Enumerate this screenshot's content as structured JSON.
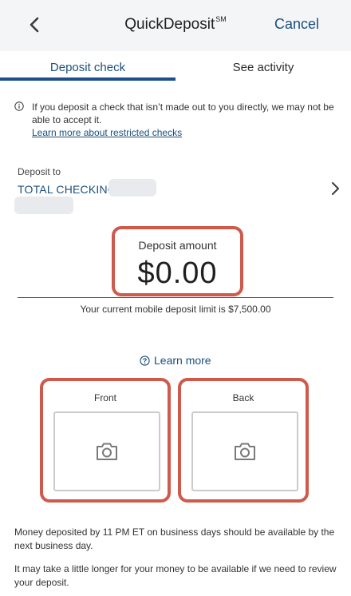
{
  "header": {
    "title": "QuickDeposit",
    "title_mark": "SM",
    "cancel_label": "Cancel",
    "back_icon": "chevron-left-icon"
  },
  "tabs": [
    {
      "label": "Deposit check",
      "active": true
    },
    {
      "label": "See activity",
      "active": false
    }
  ],
  "notice": {
    "text": "If you deposit a check that isn’t made out to you directly, we may not be able to accept it.",
    "link": "Learn more about restricted checks",
    "icon": "info-icon"
  },
  "deposit_to": {
    "label": "Deposit to",
    "account_name": "TOTAL CHECKING"
  },
  "amount": {
    "label": "Deposit amount",
    "value": "$0.00",
    "limit_text": "Your current mobile deposit limit is $7,500.00"
  },
  "learn_more": {
    "label": "Learn more",
    "icon": "help-circle-icon"
  },
  "check_images": [
    {
      "label": "Front",
      "icon": "camera-icon"
    },
    {
      "label": "Back",
      "icon": "camera-icon"
    }
  ],
  "footer": {
    "availability": "Money deposited by 11 PM ET on business days should be available by the next business day.",
    "review": "It may take a little longer for your money to be available if we need to review your deposit."
  },
  "colors": {
    "brand_blue": "#1c4f7c",
    "tab_indicator": "#1f4e8c",
    "highlight_red": "#cf5a4c",
    "header_bg": "#f4f5f7"
  }
}
